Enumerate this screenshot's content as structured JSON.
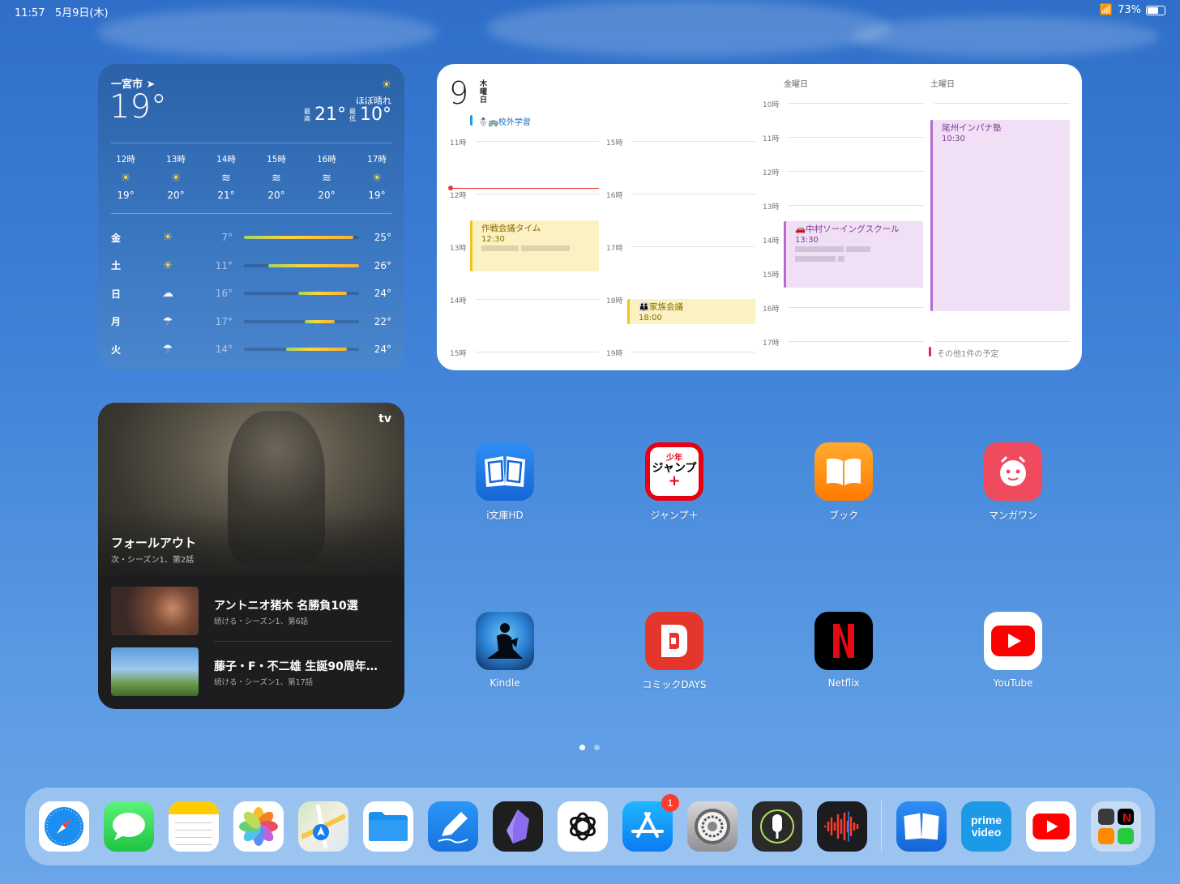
{
  "status": {
    "time": "11:57",
    "date": "5月9日(木)",
    "battery": "73%",
    "battery_level": 0.73
  },
  "weather": {
    "city": "一宮市",
    "temp": "19°",
    "condition": "ほぼ晴れ",
    "high_label": "最高",
    "high": "21°",
    "low_label": "最低",
    "low": "10°",
    "hourly": [
      {
        "time": "12時",
        "icon": "sun-icon",
        "temp": "19°"
      },
      {
        "time": "13時",
        "icon": "sun-icon",
        "temp": "20°"
      },
      {
        "time": "14時",
        "icon": "wind-icon",
        "temp": "21°"
      },
      {
        "time": "15時",
        "icon": "wind-icon",
        "temp": "20°"
      },
      {
        "time": "16時",
        "icon": "wind-icon",
        "temp": "20°"
      },
      {
        "time": "17時",
        "icon": "sun-icon",
        "temp": "19°"
      }
    ],
    "daily": [
      {
        "day": "金",
        "icon": "sun-icon",
        "low": "7°",
        "high": "25°",
        "range": [
          7,
          25
        ]
      },
      {
        "day": "土",
        "icon": "sun-icon",
        "low": "11°",
        "high": "26°",
        "range": [
          11,
          26
        ]
      },
      {
        "day": "日",
        "icon": "cloud-icon",
        "low": "16°",
        "high": "24°",
        "range": [
          16,
          24
        ]
      },
      {
        "day": "月",
        "icon": "rain-cloud-icon",
        "low": "17°",
        "high": "22°",
        "range": [
          17,
          22
        ]
      },
      {
        "day": "火",
        "icon": "rain-cloud-icon",
        "low": "14°",
        "high": "24°",
        "range": [
          14,
          24
        ]
      }
    ]
  },
  "calendar": {
    "day_number": "9",
    "day_name": "木曜日",
    "all_day_event": "☃️🚌校外学習",
    "col1_hours": [
      "11時",
      "12時",
      "13時",
      "14時",
      "15時"
    ],
    "col2_hours": [
      "15時",
      "16時",
      "17時",
      "18時",
      "19時"
    ],
    "friday_label": "金曜日",
    "saturday_label": "土曜日",
    "friday_hours": [
      "10時",
      "11時",
      "12時",
      "13時",
      "14時",
      "15時",
      "16時",
      "17時"
    ],
    "events": [
      {
        "title": "作戦会議タイム",
        "time": "12:30"
      },
      {
        "title": "👪家族会議",
        "time": "18:00"
      },
      {
        "title": "🚗中村ソーイングスクール",
        "time": "13:30"
      },
      {
        "title": "尾州インパナ塾",
        "time": "10:30"
      }
    ],
    "more": "その他1件の予定"
  },
  "tv": {
    "logo": "tv",
    "hero_title": "フォールアウト",
    "hero_sub": "次・シーズン1、第2話",
    "items": [
      {
        "title": "アントニオ猪木 名勝負10選",
        "sub": "続ける・シーズン1、第6話"
      },
      {
        "title": "藤子・F・不二雄 生誕90周年…",
        "sub": "続ける・シーズン1、第17話"
      }
    ]
  },
  "apps": [
    {
      "label": "i文庫HD",
      "icon": "book-reader-icon"
    },
    {
      "label": "ジャンプ＋",
      "icon": "jump-plus-icon"
    },
    {
      "label": "ブック",
      "icon": "books-icon"
    },
    {
      "label": "マンガワン",
      "icon": "manga-one-icon"
    },
    {
      "label": "Kindle",
      "icon": "kindle-icon"
    },
    {
      "label": "コミックDAYS",
      "icon": "comic-days-icon"
    },
    {
      "label": "Netflix",
      "icon": "netflix-icon"
    },
    {
      "label": "YouTube",
      "icon": "youtube-icon"
    }
  ],
  "jump_text": "ジャンプ",
  "jump_top": "少年",
  "dock": {
    "appstore_badge": "1",
    "prime_text": "prime video",
    "icons": [
      "safari-icon",
      "messages-icon",
      "notes-icon",
      "photos-icon",
      "maps-icon",
      "files-icon",
      "freeform-icon",
      "obsidian-icon",
      "chatgpt-icon",
      "app-store-icon",
      "settings-icon",
      "podcast-mic-icon",
      "voice-memos-icon",
      "book-reader-icon",
      "prime-video-icon",
      "youtube-icon",
      "app-library-icon"
    ]
  }
}
